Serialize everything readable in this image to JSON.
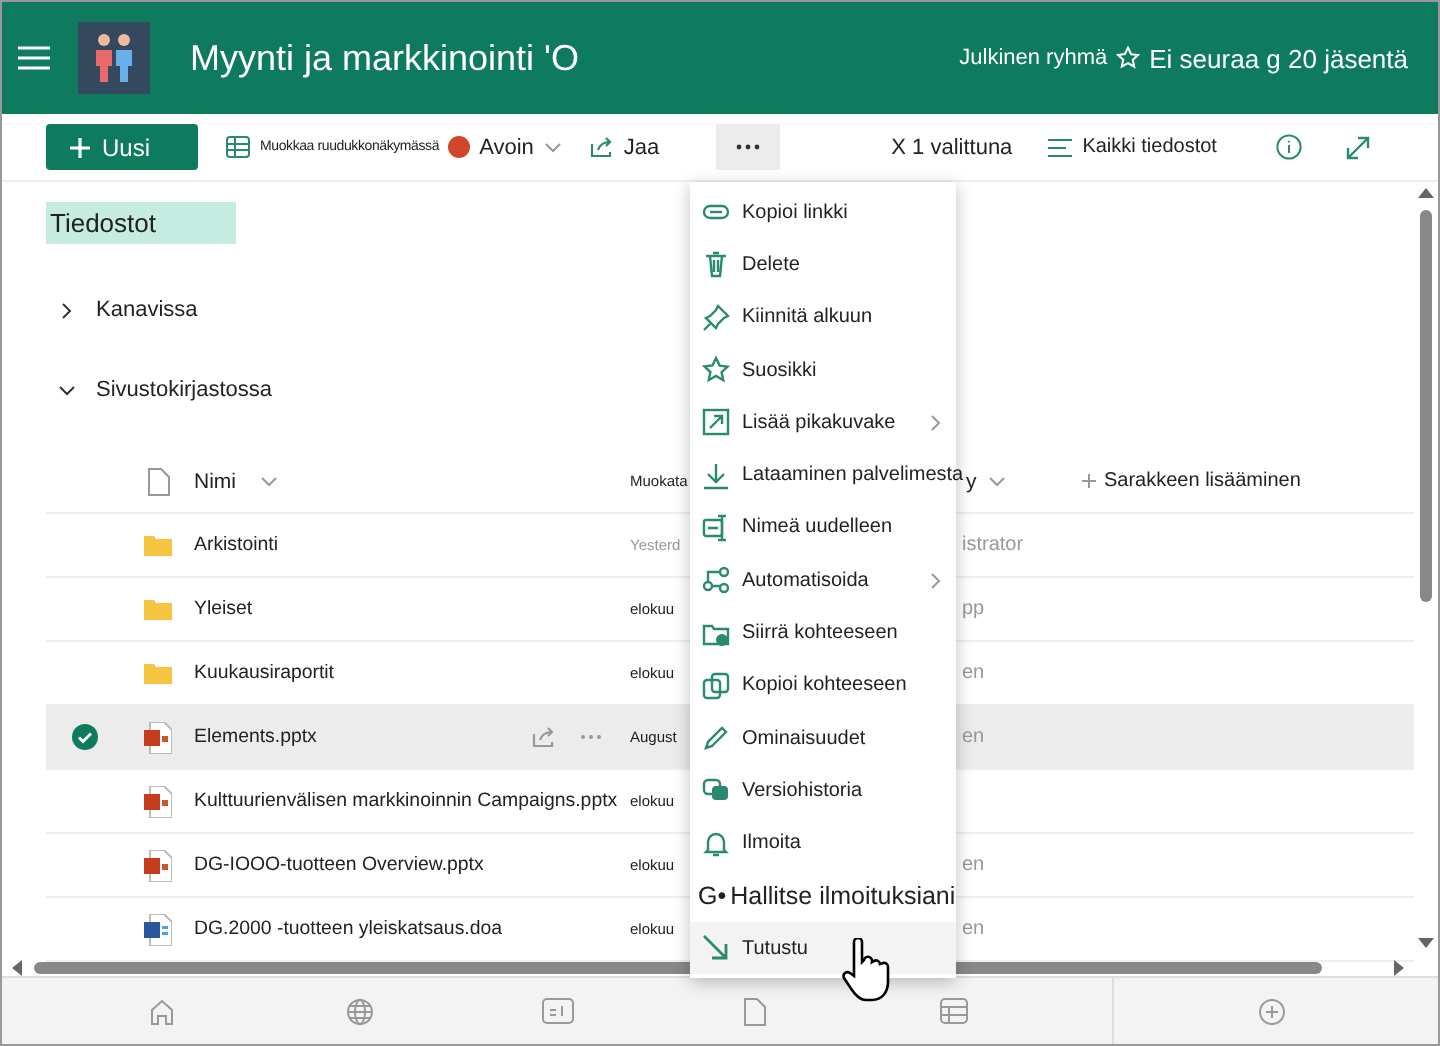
{
  "header": {
    "title": "Myynti ja markkinointi 'O",
    "group_type": "Julkinen ryhmä",
    "follow_status": "Ei seuraa g 20 jäsentä"
  },
  "toolbar": {
    "new_label": "Uusi",
    "edit_grid": "Muokkaa ruudukkonäkymässä",
    "open": "Avoin",
    "share": "Jaa",
    "more_selected": true,
    "selection": "X 1 valittuna",
    "view": "Kaikki tiedostot"
  },
  "page_title": "Tiedostot",
  "sections": [
    {
      "label": "Kanavissa",
      "expanded": false
    },
    {
      "label": "Sivustokirjastossa",
      "expanded": true
    }
  ],
  "table": {
    "columns": [
      {
        "label": "Nimi"
      },
      {
        "label": "Muokata"
      },
      {
        "label": "y"
      },
      {
        "label": "Sarakkeen lisääminen"
      }
    ],
    "rows": [
      {
        "kind": "folder",
        "name": "Arkistointi",
        "modified": "Yesterd",
        "column_4": "istrator",
        "selected": false
      },
      {
        "kind": "folder",
        "name": "Yleiset",
        "modified": "elokuu",
        "column_4": "pp",
        "selected": false
      },
      {
        "kind": "folder",
        "name": "Kuukausiraportit",
        "modified": "elokuu",
        "column_4": "en",
        "selected": false
      },
      {
        "kind": "pptx",
        "name": "Elements.pptx",
        "modified": "August",
        "column_4": "en",
        "selected": true
      },
      {
        "kind": "pptx",
        "name": "Kulttuurienvälisen markkinoinnin Campaigns.pptx",
        "modified": "elokuu",
        "selected": false
      },
      {
        "kind": "pptx",
        "name": "DG-IOOO-tuotteen Overview.pptx",
        "modified": "elokuu",
        "column_4": "en",
        "selected": false
      },
      {
        "kind": "docx",
        "name": "DG.2000 -tuotteen yleiskatsaus.doa",
        "modified": "elokuu",
        "column_4": "en",
        "selected": false
      }
    ]
  },
  "menu": [
    {
      "kind": "link",
      "label": "Kopioi linkki",
      "submenu": false,
      "hovered": false
    },
    {
      "kind": "trash",
      "label": "Delete",
      "submenu": false,
      "hovered": false
    },
    {
      "kind": "pin",
      "label": "Kiinnitä alkuun",
      "submenu": false,
      "hovered": false
    },
    {
      "kind": "star",
      "label": "Suosikki",
      "submenu": false,
      "hovered": false
    },
    {
      "kind": "shortcut",
      "label": "Lisää pikakuvake",
      "submenu": true,
      "hovered": false
    },
    {
      "kind": "download",
      "label": "Lataaminen palvelimesta",
      "submenu": false,
      "hovered": false
    },
    {
      "kind": "rename",
      "label": "Nimeä uudelleen",
      "submenu": false,
      "hovered": false
    },
    {
      "kind": "automate",
      "label": "Automatisoida",
      "submenu": true,
      "hovered": false
    },
    {
      "kind": "move",
      "label": "Siirrä kohteeseen",
      "submenu": false,
      "hovered": false
    },
    {
      "kind": "copy",
      "label": "Kopioi kohteeseen",
      "submenu": false,
      "hovered": false
    },
    {
      "kind": "pencil",
      "label": "Ominaisuudet",
      "submenu": false,
      "hovered": false
    },
    {
      "kind": "history",
      "label": "Versiohistoria",
      "submenu": false,
      "hovered": false
    },
    {
      "kind": "bell",
      "label": "Ilmoita",
      "submenu": false,
      "hovered": false
    },
    {
      "kind": "glyph",
      "glyph": "G•",
      "label": "Hallitse ilmoituksiani",
      "submenu": false,
      "hovered": false
    },
    {
      "kind": "arrow",
      "label": "Tutustu",
      "submenu": false,
      "hovered": true
    }
  ]
}
